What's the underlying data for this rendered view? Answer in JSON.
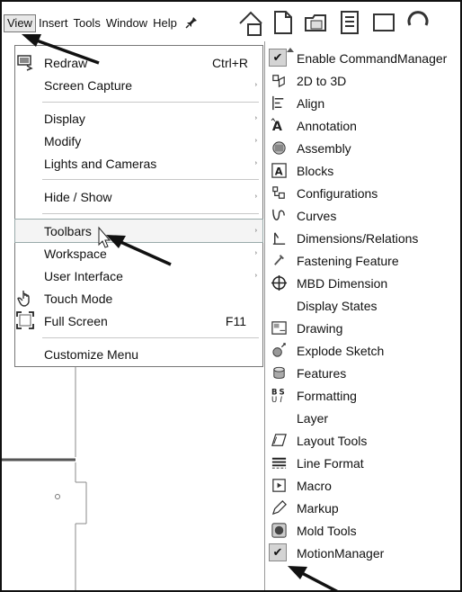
{
  "menubar": {
    "items": [
      "View",
      "Insert",
      "Tools",
      "Window",
      "Help"
    ],
    "pin_glyph": "✱"
  },
  "view_menu": {
    "items": [
      {
        "label": "Redraw",
        "shortcut": "Ctrl+R",
        "icon": "redraw-icon"
      },
      {
        "label": "Screen Capture",
        "submenu": true
      },
      {
        "label": "Display",
        "submenu": true
      },
      {
        "label": "Modify",
        "submenu": true
      },
      {
        "label": "Lights and Cameras",
        "submenu": true
      },
      {
        "label": "Hide / Show",
        "submenu": true
      },
      {
        "label": "Toolbars",
        "submenu": true,
        "highlighted": true
      },
      {
        "label": "Workspace",
        "submenu": true
      },
      {
        "label": "User Interface",
        "submenu": true
      },
      {
        "label": "Touch Mode",
        "icon": "touch-mode-icon"
      },
      {
        "label": "Full Screen",
        "shortcut": "F11",
        "icon": "full-screen-icon"
      },
      {
        "label": "Customize Menu"
      }
    ],
    "submenu_arrow": "›"
  },
  "toolbars_menu": {
    "items": [
      {
        "label": "Enable CommandManager",
        "checked": true
      },
      {
        "label": "2D to 3D",
        "icon": "2d-to-3d-icon"
      },
      {
        "label": "Align",
        "icon": "align-icon"
      },
      {
        "label": "Annotation",
        "icon": "annotation-icon"
      },
      {
        "label": "Assembly",
        "icon": "assembly-icon"
      },
      {
        "label": "Blocks",
        "icon": "blocks-icon"
      },
      {
        "label": "Configurations",
        "icon": "configurations-icon"
      },
      {
        "label": "Curves",
        "icon": "curves-icon"
      },
      {
        "label": "Dimensions/Relations",
        "icon": "dimensions-icon"
      },
      {
        "label": "Fastening Feature",
        "icon": "fastening-icon"
      },
      {
        "label": "MBD Dimension",
        "icon": "mbd-dimension-icon"
      },
      {
        "label": "Display States"
      },
      {
        "label": "Drawing",
        "icon": "drawing-icon"
      },
      {
        "label": "Explode Sketch",
        "icon": "explode-sketch-icon"
      },
      {
        "label": "Features",
        "icon": "features-icon"
      },
      {
        "label": "Formatting",
        "icon": "formatting-icon"
      },
      {
        "label": "Layer"
      },
      {
        "label": "Layout Tools",
        "icon": "layout-tools-icon"
      },
      {
        "label": "Line Format",
        "icon": "line-format-icon"
      },
      {
        "label": "Macro",
        "icon": "macro-icon"
      },
      {
        "label": "Markup",
        "icon": "markup-icon"
      },
      {
        "label": "Mold Tools",
        "icon": "mold-tools-icon"
      },
      {
        "label": "MotionManager",
        "checked": true
      }
    ],
    "check_glyph": "✔"
  }
}
